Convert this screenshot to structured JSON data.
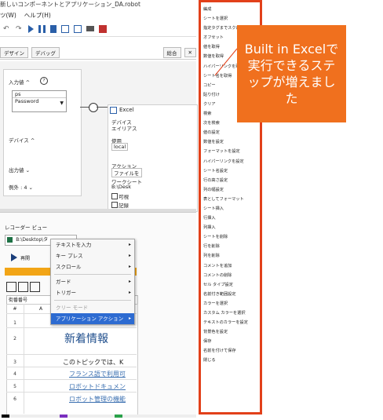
{
  "window": {
    "title": "新しいコンポーネントとアプリケーション_DA.robot"
  },
  "menubar": [
    "ツ(W)",
    "ヘルプ(H)"
  ],
  "view_tabs": [
    "デザイン",
    "デバッグ"
  ],
  "doc_tabs": [
    "総合",
    "✕"
  ],
  "step": {
    "input_label": "入力値 ^",
    "input_values": [
      "ps",
      "Password"
    ],
    "device_label": "デバイス ^",
    "output_label": "出力値 ⌄",
    "example_label": "例外 : 4 ⌄"
  },
  "excel_node": {
    "title": "Excel",
    "device_label": "デバイス",
    "device_sub": "エイリアス",
    "use_label": "使用",
    "use_value": "local",
    "action_label": "アクション",
    "action_value": "ファイルを",
    "worksheet_label": "ワークシート",
    "worksheet_value": "B:\\Desk",
    "check1": "可視",
    "check2": "記録"
  },
  "recorder": {
    "title": "レコーダー ビュー",
    "path": "B:\\Desktop\\タ",
    "play_label": "再開"
  },
  "sheet": {
    "cell_ref": "街番番号",
    "col_a": "A",
    "rows": [
      "#",
      "1",
      "2",
      "3",
      "4",
      "5",
      "6"
    ],
    "heading": "新着情報",
    "text": "このトピックでは、K",
    "links": [
      "フランス語で利用可",
      "ロボットドキュメン",
      "ロボット管理の機能"
    ]
  },
  "context_menu": [
    {
      "label": "テキストを入力",
      "arrow": "▸",
      "disabled": false
    },
    {
      "label": "キー プレス",
      "arrow": "▸",
      "disabled": false
    },
    {
      "label": "スクロール",
      "arrow": "▸",
      "disabled": false
    },
    {
      "label": "ガード",
      "arrow": "▸",
      "disabled": false
    },
    {
      "label": "トリガー",
      "arrow": "▸",
      "disabled": false
    },
    {
      "label": "クリー モード",
      "arrow": "",
      "disabled": true
    },
    {
      "label": "アプリケーション アクション",
      "arrow": "▸",
      "disabled": false
    }
  ],
  "excel_menu": [
    "編成",
    "シートを選択",
    "指定タグまでスクロール",
    "オフセット",
    "値を取得",
    "数値を取得",
    "ハイパーリンクを取得",
    "シート名を取得",
    "コピー",
    "貼り付け",
    "クリア",
    "検索",
    "次を検索",
    "値の設定",
    "数値を設定",
    "フォーマットを設定",
    "ハイパーリンクを設定",
    "シート名設定",
    "行の高さ設定",
    "列の幅設定",
    "表としてフォーマット",
    "シート挿入",
    "行挿入",
    "列挿入",
    "シートを削除",
    "行を削除",
    "列を削除",
    "コメントを追加",
    "コメントの削除",
    "セル タイプ設定",
    "名前付き範囲設定",
    "カラーを選択",
    "カスタム カラーを選択",
    "テキストのカラーを設定",
    "背景色を設定",
    "保存",
    "名前を付けて保存",
    "閉じる"
  ],
  "callout": {
    "text": "Built in Excelで実行できるステップが増えました"
  },
  "colors": {
    "callout_bg": "#f0701e",
    "menu_border": "#e2401a",
    "highlight": "#2d6bd1"
  }
}
